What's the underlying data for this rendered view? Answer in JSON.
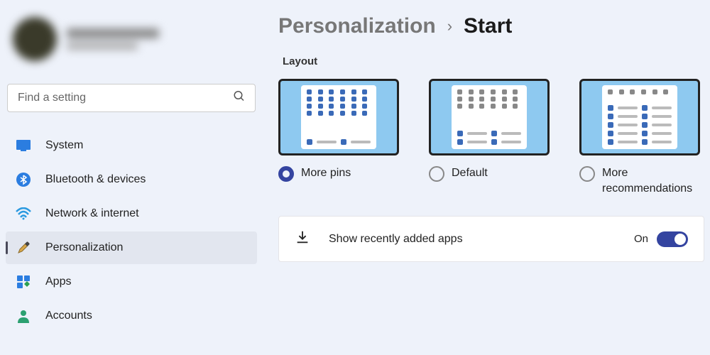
{
  "search": {
    "placeholder": "Find a setting"
  },
  "sidebar": {
    "items": [
      {
        "label": "System"
      },
      {
        "label": "Bluetooth & devices"
      },
      {
        "label": "Network & internet"
      },
      {
        "label": "Personalization"
      },
      {
        "label": "Apps"
      },
      {
        "label": "Accounts"
      }
    ]
  },
  "breadcrumb": {
    "parent": "Personalization",
    "current": "Start"
  },
  "layout": {
    "section_label": "Layout",
    "options": [
      {
        "label": "More pins",
        "selected": true
      },
      {
        "label": "Default",
        "selected": false
      },
      {
        "label": "More recommendations",
        "selected": false
      }
    ]
  },
  "settings": {
    "recently_added": {
      "label": "Show recently added apps",
      "state": "On",
      "on": true
    }
  }
}
